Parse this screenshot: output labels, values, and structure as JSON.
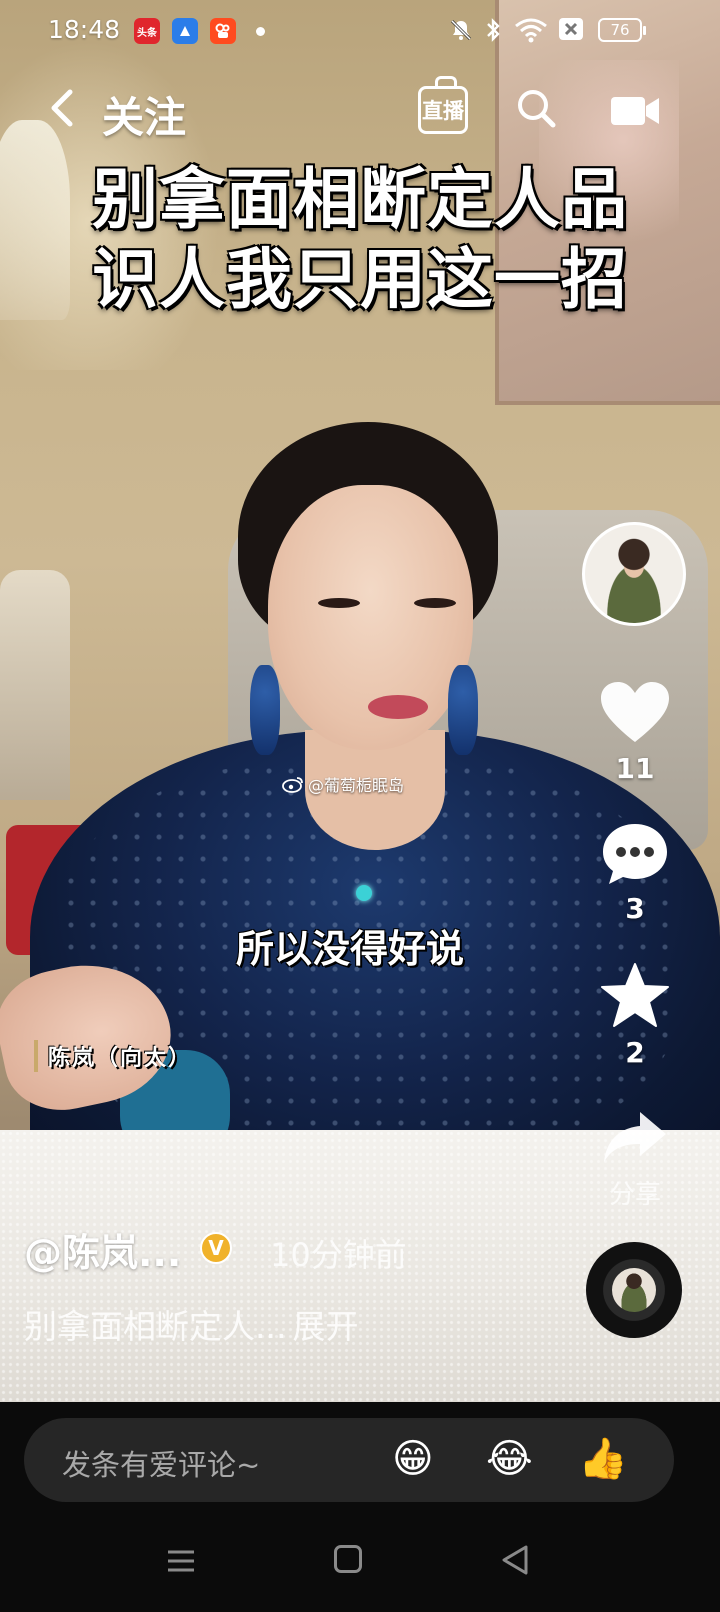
{
  "status_bar": {
    "time": "18:48",
    "apps": [
      {
        "name": "toutiao-app-icon",
        "label": "头条",
        "color": "#e0262d"
      },
      {
        "name": "blue-app-icon",
        "label": "",
        "color": "#2b7de9"
      },
      {
        "name": "kuaishou-app-icon",
        "label": "",
        "color": "#ff4b1f"
      }
    ],
    "battery": "76"
  },
  "top_nav": {
    "back_icon": "chevron-left-icon",
    "tab": "关注",
    "live_label": "直播"
  },
  "video": {
    "title_line1": "别拿面相断定人品",
    "title_line2": "识人我只用这一招",
    "watermark": "@葡萄栀眠岛",
    "subtitle": "所以没得好说",
    "name_tag": "陈岚（向太）"
  },
  "actions": {
    "likes": "11",
    "comments": "3",
    "favorites": "2",
    "share_label": "分享"
  },
  "post": {
    "author": "@陈岚...",
    "verified_badge": "V",
    "time": "10分钟前",
    "caption": "别拿面相断定人...",
    "expand": "展开"
  },
  "comment_bar": {
    "placeholder": "发条有爱评论~",
    "emojis": [
      "😁",
      "😂",
      "👍"
    ]
  },
  "colors": {
    "accent_verified": "#f0b22b",
    "comment_bar_bg": "#262626"
  }
}
